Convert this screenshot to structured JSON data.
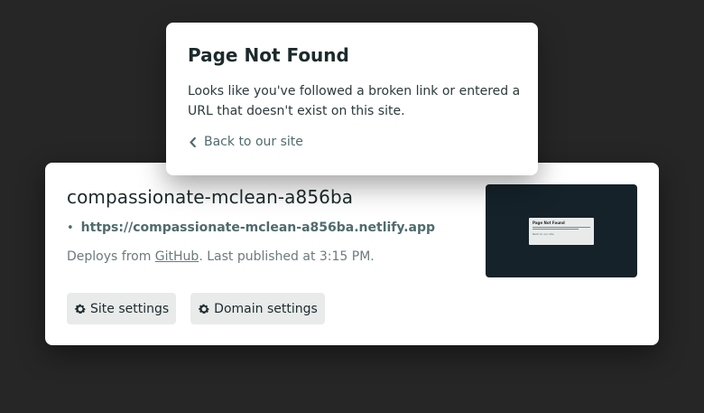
{
  "site_card": {
    "name": "compassionate-mclean-a856ba",
    "url": "https://compassionate-mclean-a856ba.netlify.app",
    "deploy_prefix": "Deploys from ",
    "deploy_source": "GitHub",
    "deploy_suffix": ". Last published at 3:15 PM.",
    "buttons": {
      "site_settings": "Site settings",
      "domain_settings": "Domain settings"
    }
  },
  "not_found": {
    "title": "Page Not Found",
    "message": "Looks like you've followed a broken link or entered a URL that doesn't exist on this site.",
    "back_link": "Back to our site"
  },
  "thumbnail": {
    "title": "Page Not Found",
    "link": "Back to our site"
  },
  "colors": {
    "background": "#262626",
    "card": "#ffffff",
    "accent": "#4f6b6d",
    "thumbnail_bg": "#15222a",
    "button_bg": "#e9ebeb"
  },
  "icons": {
    "settings": "gear-icon",
    "back": "chevron-left-icon",
    "bullet": "bullet-icon"
  }
}
